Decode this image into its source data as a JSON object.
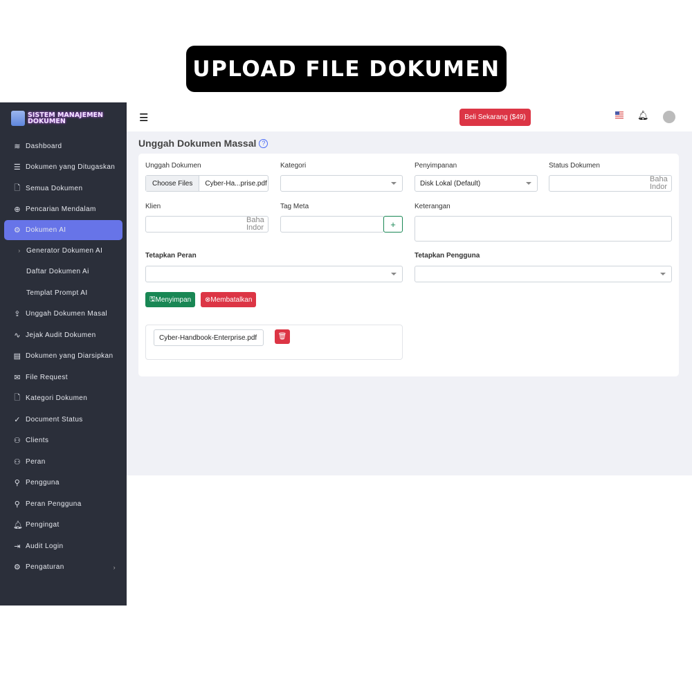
{
  "banner": "UPLOAD FILE DOKUMEN",
  "sidebar": {
    "logo": "SISTEM MANAJEMEN DOKUMEN",
    "items": [
      {
        "label": "Dashboard",
        "icon": "layers"
      },
      {
        "label": "Dokumen yang Ditugaskan",
        "icon": "list"
      },
      {
        "label": "Semua Dokumen",
        "icon": "file"
      },
      {
        "label": "Pencarian Mendalam",
        "icon": "zoom-in"
      },
      {
        "label": "Dokumen AI",
        "icon": "cpu"
      },
      {
        "label": "Generator Dokumen AI",
        "icon": "chevron-right"
      },
      {
        "label": "Daftar Dokumen Ai",
        "icon": ""
      },
      {
        "label": "Templat Prompt AI",
        "icon": ""
      },
      {
        "label": "Unggah Dokumen Masal",
        "icon": "upload"
      },
      {
        "label": "Jejak Audit Dokumen",
        "icon": "activity"
      },
      {
        "label": "Dokumen yang Diarsipkan",
        "icon": "archive"
      },
      {
        "label": "File Request",
        "icon": "inbox"
      },
      {
        "label": "Kategori Dokumen",
        "icon": "file"
      },
      {
        "label": "Document Status",
        "icon": "check"
      },
      {
        "label": "Clients",
        "icon": "users"
      },
      {
        "label": "Peran",
        "icon": "users"
      },
      {
        "label": "Pengguna",
        "icon": "user"
      },
      {
        "label": "Peran Pengguna",
        "icon": "user-check"
      },
      {
        "label": "Pengingat",
        "icon": "bell"
      },
      {
        "label": "Audit Login",
        "icon": "log-in"
      },
      {
        "label": "Pengaturan",
        "icon": "settings"
      }
    ]
  },
  "header": {
    "buy": "Beli Sekarang ($49)"
  },
  "page": {
    "title": "Unggah Dokumen Massal",
    "help": "?"
  },
  "form": {
    "upload_label": "Unggah Dokumen",
    "choose": "Choose Files",
    "chosen": "Cyber-Ha...prise.pdf",
    "category_label": "Kategori",
    "storage_label": "Penyimpanan",
    "storage_value": "Disk Lokal (Default)",
    "status_label": "Status Dokumen",
    "ghost": "Baha Indor",
    "client_label": "Klien",
    "meta_label": "Tag Meta",
    "plus": "+",
    "desc_label": "Keterangan",
    "role_label": "Tetapkan Peran",
    "user_label": "Tetapkan Pengguna",
    "save": "Menyimpan",
    "cancel": "Membatalkan",
    "file": "Cyber-Handbook-Enterprise.pdf"
  }
}
